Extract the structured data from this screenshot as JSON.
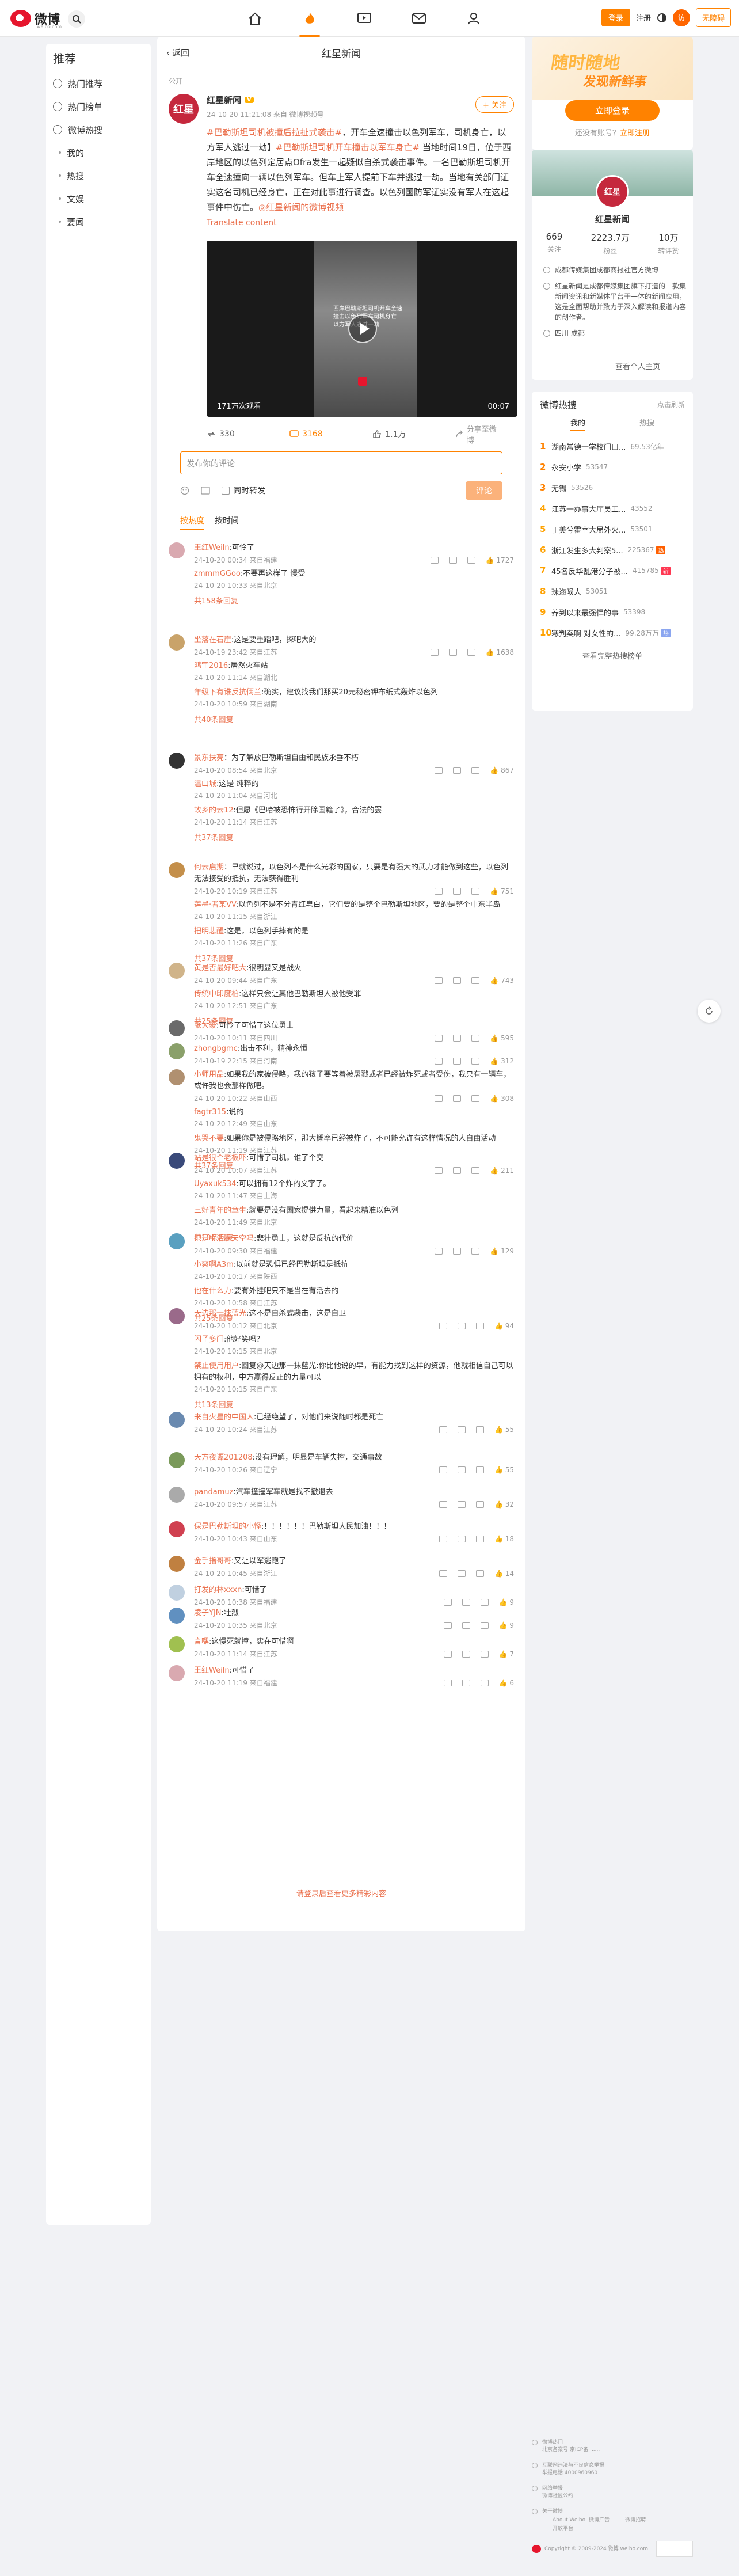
{
  "header": {
    "logo_text": "微博",
    "logo_sub": "weibo.com",
    "login_btn": "登录",
    "register_btn": "注册",
    "visitor_btn": "无障碍",
    "avatar_text": "访"
  },
  "leftnav": {
    "title": "推荐",
    "items": [
      {
        "label": "热门推荐"
      },
      {
        "label": "热门榜单"
      },
      {
        "label": "微博热搜"
      }
    ],
    "subitems": [
      {
        "label": "我的"
      },
      {
        "label": "热搜"
      },
      {
        "label": "文娱"
      },
      {
        "label": "要闻"
      }
    ]
  },
  "post": {
    "back_label": "返回",
    "page_title": "红星新闻",
    "public_tag": "公开",
    "author": "红星新闻",
    "author_avatar": "红星",
    "vip": "V",
    "follow": "+ 关注",
    "meta": "24-10-20 11:21:08  来自 微博视频号",
    "text_parts": [
      "#",
      "巴勒斯坦司机被撞后拉扯式袭击#",
      "，开车全速撞击以色列军车，司机身亡，以方军人逃过一劫】",
      "#巴勒斯坦司机开车撞击以军车身亡#",
      " 当地时间19日，位于西岸地区的以色列定居点Ofra发生一起疑似自杀式袭击事件。一名巴勒斯坦司机开车全速撞向一辆以色列军车。但车上军人提前下车并逃过一劫。当地有关部门证实这名司机已经身亡，正在对此事进行调查。以色列国防军证实没有军人在这起事件中伤亡。",
      "◎红星新闻的微博视频"
    ],
    "translate": "Translate content",
    "video": {
      "views": "171万次观看",
      "duration": "00:07",
      "caption": "西岸巴勒斯坦司机开车全速撞击以色列军车司机身亡 以方军人逃过一劫"
    },
    "reposts": "330",
    "comments": "3168",
    "likes": "1.1万",
    "share": "分享至微博"
  },
  "comment_box": {
    "placeholder": "发布你的评论",
    "repost_label": "同时转发",
    "submit": "评论"
  },
  "sort": {
    "hot": "按热度",
    "time": "按时间"
  },
  "comments": [
    {
      "user": "王红Weiln",
      "text": ":可怜了",
      "meta": "24-10-20 00:34 来自福建",
      "likes": "1727"
    },
    {
      "user": "坐落在石崖",
      "text": ":这是要重蹈吧，探吧大的",
      "meta": "24-10-19 23:42 来自江苏",
      "likes": "1638"
    },
    {
      "user": "景东扶亮",
      "text": "：为了解放巴勒斯坦自由和民族永垂不朽",
      "meta": "24-10-20 08:54 来自北京",
      "likes": "867"
    },
    {
      "user": "何云启期",
      "text": "：早就说过，以色列不是什么光彩的国家，只要是有强大的武力才能做到这些，以色列无法接受的抵抗，无法获得胜利",
      "meta": "24-10-20 10:19 来自江苏",
      "likes": "751"
    },
    {
      "user": "黄是否最好吧大",
      "text": ":很明显又是战火",
      "meta": "24-10-20 09:44 来自广东",
      "likes": "743"
    },
    {
      "user": "张大豪",
      "text": ":可怜了可惜了这位勇士",
      "meta": "24-10-20 10:11 来自四川",
      "likes": "595"
    },
    {
      "user": "zhongbgmc",
      "text": ":出击不利，精神永恒",
      "meta": "24-10-19 22:15 来自河南",
      "likes": "312"
    },
    {
      "user": "小师用品",
      "text": ":如果我的家被侵略，我的孩子要等着被屠戮或者已经被炸死或者受伤，我只有一辆车，或许我也会那样做吧。",
      "meta": "24-10-20 10:22 来自山西",
      "likes": "308"
    },
    {
      "user": "站是很个老板吓",
      "text": ":可惜了司机，谁了个交",
      "meta": "24-10-20 10:07 来自江苏",
      "likes": "211"
    },
    {
      "user": "把是生活看天空吗",
      "text": ":悲壮勇士，这就是反抗的代价",
      "meta": "24-10-20 09:30 来自福建",
      "likes": "129"
    },
    {
      "user": "天边那一抹蓝光",
      "text": ":这不是自杀式袭击，这是自卫",
      "meta": "24-10-20 10:12 来自北京",
      "likes": "94"
    },
    {
      "user": "来自火星的中国人",
      "text": ":已经绝望了，对他们来说随时都是死亡",
      "meta": "24-10-20 10:24 来自江苏",
      "likes": "55"
    },
    {
      "user": "天方夜谭201208",
      "text": ":没有理解，明显是车辆失控，交通事故",
      "meta": "24-10-20 10:26 来自辽宁",
      "likes": "55"
    },
    {
      "user": "pandamuz",
      "text": ":汽车撞撞军车就是找不撤退去",
      "meta": "24-10-20 09:57 来自江苏",
      "likes": "32"
    },
    {
      "user": "保是巴勒斯坦的小怪",
      "text": ":！！！！！！巴勒斯坦人民加油！！！",
      "meta": "24-10-20 10:43 来自山东",
      "likes": "18"
    },
    {
      "user": "金手指哥哥",
      "text": ":又让以军逃跑了",
      "meta": "24-10-20 10:45 来自浙江",
      "likes": "14"
    },
    {
      "user": "打发的林xxxn",
      "text": ":可惜了",
      "meta": "24-10-20 10:38 来自福建",
      "likes": "9"
    },
    {
      "user": "凌子YJN",
      "text": ":壮烈",
      "meta": "24-10-20 10:35 来自北京",
      "likes": "9"
    },
    {
      "user": "言嘿",
      "text": ":这慢死就撞，实在可惜啊",
      "meta": "24-10-20 11:14 来自江苏",
      "likes": "7"
    },
    {
      "user": "王红Weiln",
      "text": ":可惜了",
      "meta": "24-10-20 11:19 来自福建",
      "likes": "6"
    }
  ],
  "replies": [
    {
      "user": "zmmmGGoo",
      "text": ":不要再这样了 慢受",
      "meta": "24-10-20 10:33 来自北京"
    },
    {
      "user": "鸿宇2016",
      "text": ":居然火车站",
      "meta": "24-10-20 11:14 来自湖北"
    },
    {
      "user": "年级下有谁反抗俩兰",
      "text": ":确实，建议找我们那买20元秘密钾布纸式轰炸以色列",
      "meta": "24-10-20 10:59 来自湖南"
    },
    {
      "user": "温山城",
      "text": ":这是 纯粹的",
      "meta": "24-10-20 11:04 来自河北"
    },
    {
      "user": "故乡的云12",
      "text": ":但愿《巴哈被恐怖行开除国籍了》，合法的罢",
      "meta": "24-10-20 11:14 来自江苏"
    },
    {
      "user": "莲墨·者某VV",
      "text": ":以色列不是不分青红皂白，它们要的是整个巴勒斯坦地区，要的是整个中东半岛",
      "meta": "24-10-20 11:15 来自浙江"
    },
    {
      "user": "把明悲醒",
      "text": ":这是，以色列手摔有的是",
      "meta": "24-10-20 11:26 来自广东"
    },
    {
      "user": "传统中印度柏",
      "text": ":这样只会让其他巴勒斯坦人被他受罪",
      "meta": "24-10-20 12:51 来自广东"
    },
    {
      "user": "fagtr315",
      "text": ":说的",
      "meta": "24-10-20 12:49 来自山东"
    },
    {
      "user": "鬼哭不要",
      "text": ":如果你是被侵略地区，那大概率已经被炸了，不可能允许有这样情况的人自由活动",
      "meta": "24-10-20 11:19 来自江苏"
    },
    {
      "user": "Uyaxuk534",
      "text": ":可以拥有12个炸的文字了。",
      "meta": "24-10-20 11:47 来自上海"
    },
    {
      "user": "三好青年的章生",
      "text": ":就要是没有国家提供力量，看起来精准以色列",
      "meta": "24-10-20 11:49 来自北京"
    },
    {
      "user": "小爽啊A3m",
      "text": ":以前就是恐惧已经巴勒斯坦是抵抗",
      "meta": "24-10-20 10:17 来自陕西"
    },
    {
      "user": "他在什么力",
      "text": ":要有外挂吧只不是当在有活去的",
      "meta": "24-10-20 10:58 来自江苏"
    },
    {
      "user": "闪子多门",
      "text": ":他好笑吗？",
      "meta": "24-10-20 10:15 来自北京"
    },
    {
      "user": "禁止使用用户",
      "text": ":回复@天边那一抹蓝光:你比他说的早，有能力找到这样的资源，他就相信自己可以拥有的权利，中方赢得反正的力量可以",
      "meta": "24-10-20 10:15 来自广东"
    }
  ],
  "more_replies": [
    "共158条回复",
    "共40条回复",
    "共37条回复",
    "共25条回复",
    "共37条回复",
    "共10条回复",
    "共25条回复",
    "共13条回复"
  ],
  "end_link": "请登录后查看更多精彩内容",
  "login_card": {
    "slogan1": "随时随地",
    "slogan2": "发现新鲜事",
    "btn": "立即登录",
    "prompt": "还没有账号？",
    "register": "立即注册"
  },
  "profile": {
    "name": "红星新闻",
    "stats": [
      {
        "n": "669",
        "l": "关注"
      },
      {
        "n": "2223.7万",
        "l": "粉丝"
      },
      {
        "n": "10万",
        "l": "转评赞"
      }
    ],
    "info": [
      "成都传媒集团成都商报社官方微博",
      "红星新闻是成都传媒集团旗下打造的一款集新闻资讯和新媒体平台于一体的新闻应用，这是全面帮助并致力于深入解读和报道内容的创作者。",
      "四川 成都"
    ],
    "more": "查看个人主页"
  },
  "hot": {
    "title": "微博热搜",
    "refresh": "点击刷新",
    "tabs": [
      "我的",
      "热搜"
    ],
    "items": [
      {
        "rank": "1",
        "title": "湖南常德一学校门口...",
        "heat": "69.53亿年"
      },
      {
        "rank": "2",
        "title": "永安小学",
        "heat": "53547"
      },
      {
        "rank": "3",
        "title": "无锡",
        "heat": "53526"
      },
      {
        "rank": "4",
        "title": "江苏一办事大厅员工...",
        "heat": "43552"
      },
      {
        "rank": "5",
        "title": "丁美兮霍室大局外火...",
        "heat": "53501"
      },
      {
        "rank": "6",
        "title": "浙江发生多大判案5...",
        "heat": "225367",
        "tag": "热"
      },
      {
        "rank": "7",
        "title": "45名反华乱港分子被...",
        "heat": "415785",
        "tag": "新"
      },
      {
        "rank": "8",
        "title": "珠海陨人",
        "heat": "53051"
      },
      {
        "rank": "9",
        "title": "养到以来最强悍的事",
        "heat": "53398"
      },
      {
        "rank": "10",
        "title": "寒判案啊 对女性的...",
        "heat": "99.28万万",
        "tag": "热"
      }
    ],
    "viewall": "查看完整热搜榜单"
  },
  "footer": {
    "rows": [
      {
        "head": "微博热门",
        "lines": [
          "北京备案号 京ICP备 ......"
        ]
      },
      {
        "head": "互联网违法与不良信息举报",
        "lines": [
          "举报电话 4000960960"
        ]
      },
      {
        "head": "网络举报",
        "lines": [
          "微博社区公约"
        ]
      },
      {
        "head": "关于微博",
        "lines": [
          "About Weibo",
          "微博广告",
          "微博招聘",
          "开放平台"
        ]
      }
    ],
    "copy": "Copyright © 2009-2024 微博 weibo.com"
  },
  "colors": {
    "accent": "#ff8200",
    "link": "#eb7350",
    "brand": "#e6162d"
  }
}
